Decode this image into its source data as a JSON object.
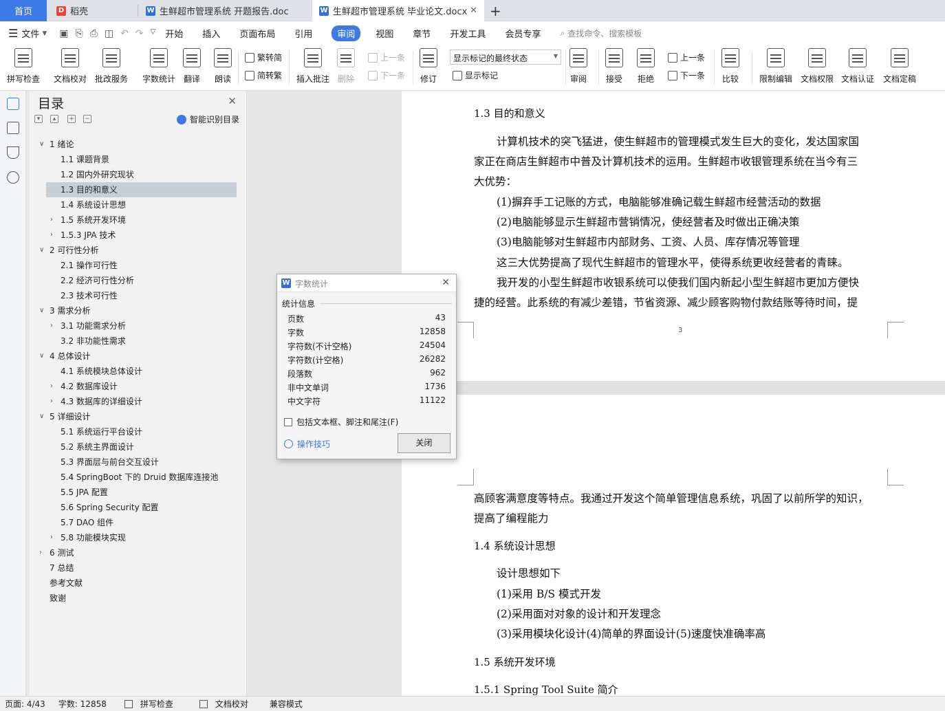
{
  "tabs": {
    "home": "首页",
    "shell": "稻壳",
    "doc1": "生鲜超市管理系统 开题报告.doc",
    "doc2": "生鲜超市管理系统 毕业论文.docx",
    "new_tab": "+"
  },
  "menu": {
    "file": "文件",
    "items": [
      "开始",
      "插入",
      "页面布局",
      "引用",
      "审阅",
      "视图",
      "章节",
      "开发工具",
      "会员专享"
    ],
    "active": "审阅",
    "search_placeholder": "查找命令、搜索模板"
  },
  "ribbon": {
    "spellcheck": "拼写检查",
    "proofread": "文档校对",
    "review_service": "批改服务",
    "word_count": "字数统计",
    "translate": "翻译",
    "read_aloud": "朗读",
    "to_traditional": "繁转简",
    "to_simplified": "简转繁",
    "insert_comment": "插入批注",
    "delete": "删除",
    "prev_comment": "上一条",
    "next_comment": "下一条",
    "track_changes": "修订",
    "display_mode": "显示标记的最终状态",
    "show_markup": "显示标记",
    "review_pane": "审阅",
    "accept": "接受",
    "reject": "拒绝",
    "prev_change": "上一条",
    "next_change": "下一条",
    "compare": "比较",
    "restrict_edit": "限制编辑",
    "doc_permission": "文档权限",
    "doc_certify": "文档认证",
    "doc_finalize": "文档定稿"
  },
  "toc": {
    "title": "目录",
    "smart": "智能识别目录",
    "items": [
      {
        "label": "1 绪论",
        "level": 1,
        "expand": "open"
      },
      {
        "label": "1.1 课题背景",
        "level": 2,
        "expand": ""
      },
      {
        "label": "1.2  国内外研究现状",
        "level": 2,
        "expand": ""
      },
      {
        "label": "1.3  目的和意义",
        "level": 2,
        "expand": "",
        "selected": true
      },
      {
        "label": "1.4  系统设计思想",
        "level": 2,
        "expand": ""
      },
      {
        "label": "1.5  系统开发环境",
        "level": 2,
        "expand": "closed"
      },
      {
        "label": "1.5.3    JPA 技术",
        "level": 2,
        "expand": "closed"
      },
      {
        "label": "2 可行性分析",
        "level": 1,
        "expand": "open"
      },
      {
        "label": "2.1  操作可行性",
        "level": 2,
        "expand": ""
      },
      {
        "label": "2.2  经济可行性分析",
        "level": 2,
        "expand": ""
      },
      {
        "label": "2.3  技术可行性",
        "level": 2,
        "expand": ""
      },
      {
        "label": "3 需求分析",
        "level": 1,
        "expand": "open"
      },
      {
        "label": "3.1  功能需求分析",
        "level": 2,
        "expand": "closed"
      },
      {
        "label": "3.2  非功能性需求",
        "level": 2,
        "expand": ""
      },
      {
        "label": "4 总体设计",
        "level": 1,
        "expand": "open"
      },
      {
        "label": "4.1  系统模块总体设计",
        "level": 2,
        "expand": ""
      },
      {
        "label": "4.2  数据库设计",
        "level": 2,
        "expand": "closed"
      },
      {
        "label": "4.3 数据库的详细设计",
        "level": 2,
        "expand": "closed"
      },
      {
        "label": "5 详细设计",
        "level": 1,
        "expand": "open"
      },
      {
        "label": "5.1  系统运行平台设计",
        "level": 2,
        "expand": ""
      },
      {
        "label": "5.2  系统主界面设计",
        "level": 2,
        "expand": ""
      },
      {
        "label": "5.3  界面层与前台交互设计",
        "level": 2,
        "expand": ""
      },
      {
        "label": "5.4 SpringBoot 下的 Druid 数据库连接池",
        "level": 2,
        "expand": ""
      },
      {
        "label": "5.5 JPA 配置",
        "level": 2,
        "expand": ""
      },
      {
        "label": "5.6 Spring Security 配置",
        "level": 2,
        "expand": ""
      },
      {
        "label": "5.7 DAO 组件",
        "level": 2,
        "expand": ""
      },
      {
        "label": "5.8  功能模块实现",
        "level": 2,
        "expand": "closed"
      },
      {
        "label": "6 测试",
        "level": 1,
        "expand": "closed"
      },
      {
        "label": "7 总结",
        "level": 1,
        "expand": ""
      },
      {
        "label": "参考文献",
        "level": 1,
        "expand": ""
      },
      {
        "label": "致谢",
        "level": 1,
        "expand": ""
      }
    ]
  },
  "doc": {
    "h13": "1.3  目的和意义",
    "p1_l1": "计算机技术的突飞猛进，使生鲜超市的管理模式发生巨大的变化，发达国家国",
    "p1_l2": "家正在商店生鲜超市中普及计算机技术的运用。生鲜超市收银管理系统在当今有三",
    "p1_l3": "大优势：",
    "li1": "(1)摒弃手工记账的方式，电脑能够准确记载生鲜超市经营活动的数据",
    "li2": "(2)电脑能够显示生鲜超市营销情况，使经营者及时做出正确决策",
    "li3": "(3)电脑能够对生鲜超市内部财务、工资、人员、库存情况等管理",
    "p2": "这三大优势提高了现代生鲜超市的管理水平，使得系统更收经营者的青睐。",
    "p3_l1": "我开发的小型生鲜超市收银系统可以使我们国内新起小型生鲜超市更加方便快",
    "p3_l2": "捷的经营。此系统的有减少差错，节省资源、减少顾客购物付款结账等待时间，提",
    "page_number": "3",
    "p4_l1": "高顾客满意度等特点。我通过开发这个简单管理信息系统，巩固了以前所学的知识，",
    "p4_l2": "提高了编程能力",
    "h14": "1.4  系统设计思想",
    "d0": "设计思想如下",
    "d1": "(1)采用 B/S 模式开发",
    "d2": "(2)采用面对对象的设计和开发理念",
    "d3": "(3)采用模块化设计(4)简单的界面设计(5)速度快准确率高",
    "h15": "1.5  系统开发环境",
    "h151": "1.5.1 Spring Tool Suite 简介"
  },
  "dialog": {
    "title": "字数统计",
    "section": "统计信息",
    "rows": [
      {
        "label": "页数",
        "value": "43"
      },
      {
        "label": "字数",
        "value": "12858"
      },
      {
        "label": "字符数(不计空格)",
        "value": "24504"
      },
      {
        "label": "字符数(计空格)",
        "value": "26282"
      },
      {
        "label": "段落数",
        "value": "962"
      },
      {
        "label": "非中文单词",
        "value": "1736"
      },
      {
        "label": "中文字符",
        "value": "11122"
      }
    ],
    "checkbox": "包括文本框、脚注和尾注(F)",
    "tips": "操作技巧",
    "close": "关闭"
  },
  "status": {
    "page": "页面: 4/43",
    "words": "字数: 12858",
    "spell": "拼写检查",
    "proof": "文档校对",
    "compat": "兼容模式"
  },
  "colors": {
    "accent": "#3c7ae8",
    "selection": "#c8ced6"
  }
}
